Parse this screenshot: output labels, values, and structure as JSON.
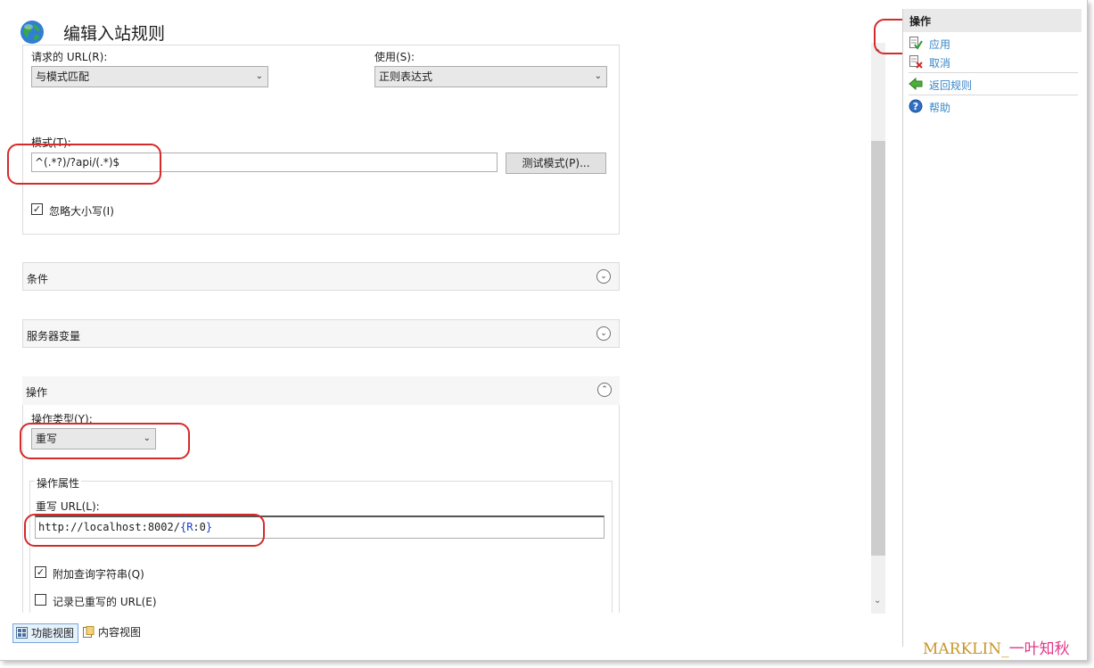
{
  "header": {
    "title": "编辑入站规则"
  },
  "match": {
    "requested_url_label": "请求的 URL(R):",
    "requested_url_value": "与模式匹配",
    "using_label": "使用(S):",
    "using_value": "正则表达式",
    "pattern_label": "模式(T):",
    "pattern_value": "^(.*?)/?api/(.*)$",
    "test_button": "测试模式(P)...",
    "ignore_case_label": "忽略大小写(I)",
    "ignore_case_checked": true
  },
  "sections": {
    "conditions": "条件",
    "server_variables": "服务器变量",
    "action": "操作"
  },
  "action": {
    "type_label": "操作类型(Y):",
    "type_value": "重写",
    "properties_legend": "操作属性",
    "rewrite_url_label": "重写 URL(L):",
    "rewrite_url_prefix": "http://localhost:8002/",
    "rewrite_url_brace_open": "{",
    "rewrite_url_var": "R",
    "rewrite_url_sep": ":",
    "rewrite_url_num": "0",
    "rewrite_url_brace_close": "}",
    "append_query_label": "附加查询字符串(Q)",
    "append_query_checked": true,
    "log_rewritten_label": "记录已重写的 URL(E)",
    "log_rewritten_checked": false
  },
  "bottom_tabs": {
    "features_view": "功能视图",
    "content_view": "内容视图"
  },
  "actions_pane": {
    "title": "操作",
    "apply": "应用",
    "cancel": "取消",
    "back_to_rules": "返回规则",
    "help": "帮助"
  },
  "watermark": {
    "latin": "MARKLIN_",
    "cn": "一叶知秋"
  },
  "colors": {
    "accent_link": "#3a87c8",
    "annotation_red": "#d42a2a",
    "panel_bg": "#e9e9e9"
  }
}
